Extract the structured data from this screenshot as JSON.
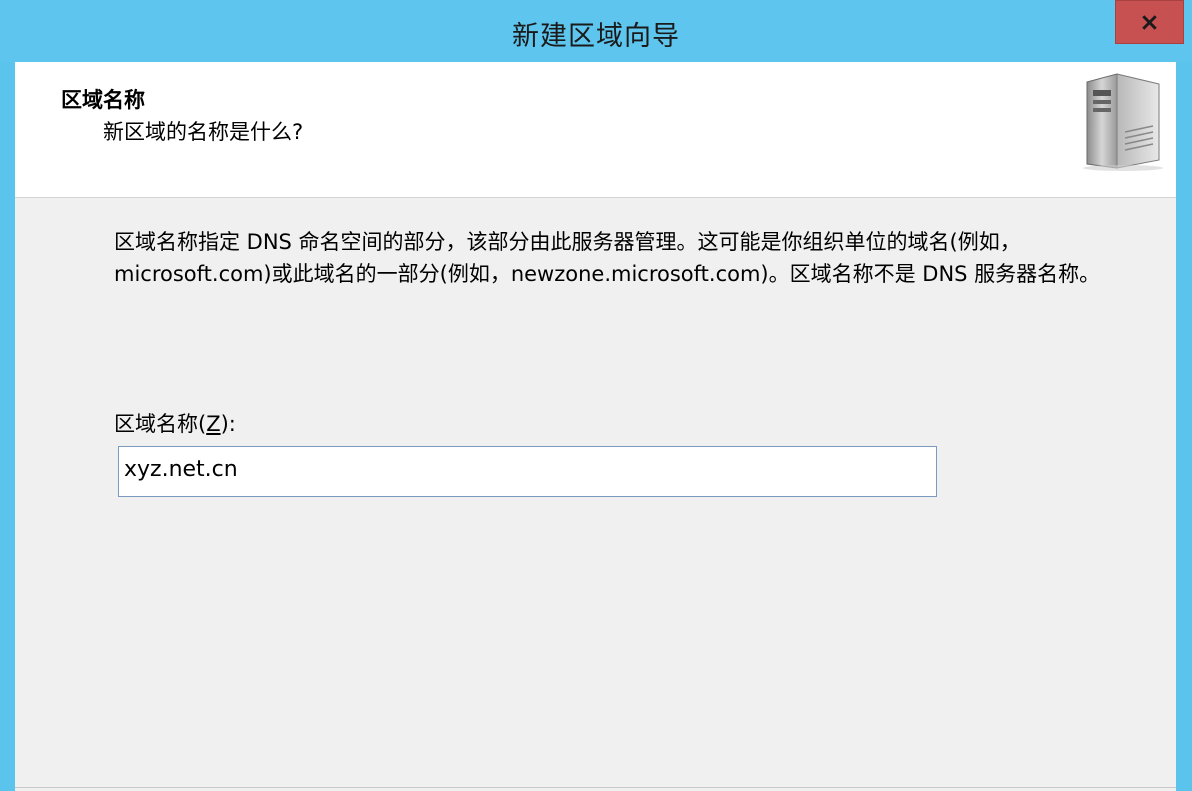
{
  "window": {
    "title": "新建区域向导"
  },
  "header": {
    "title": "区域名称",
    "subtitle": "新区域的名称是什么?"
  },
  "body": {
    "description": "区域名称指定 DNS 命名空间的部分，该部分由此服务器管理。这可能是你组织单位的域名(例如，microsoft.com)或此域名的一部分(例如，newzone.microsoft.com)。区域名称不是 DNS 服务器名称。",
    "field_label_text": "区域名称(",
    "field_label_mnemonic": "Z",
    "field_label_suffix": "):",
    "zone_name_value": "xyz.net.cn"
  },
  "icons": {
    "close": "close-icon",
    "server": "server-icon"
  },
  "colors": {
    "titlebar": "#5ec5ee",
    "close_button": "#c75050",
    "panel_background": "#f0f0f0",
    "input_border": "#7a9ac0"
  }
}
